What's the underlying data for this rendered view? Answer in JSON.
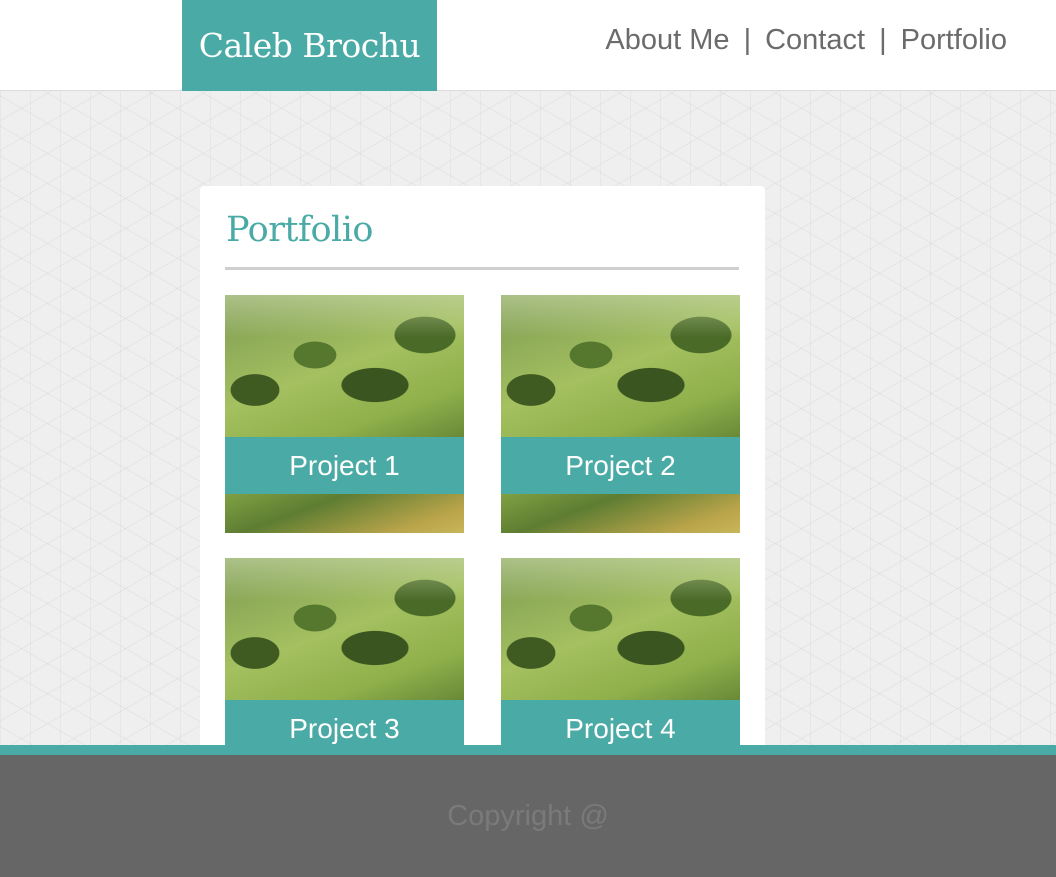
{
  "header": {
    "brand": "Caleb Brochu",
    "nav": [
      {
        "label": "About Me"
      },
      {
        "label": "Contact"
      },
      {
        "label": "Portfolio"
      }
    ],
    "separator": "|"
  },
  "main": {
    "title": "Portfolio",
    "projects": [
      {
        "label": "Project 1"
      },
      {
        "label": "Project 2"
      },
      {
        "label": "Project 3"
      },
      {
        "label": "Project 4"
      }
    ]
  },
  "footer": {
    "copyright": "Copyright @"
  },
  "colors": {
    "accent": "#4aaaa5",
    "footer_bg": "#666666",
    "nav_text": "#6b6b6b"
  }
}
